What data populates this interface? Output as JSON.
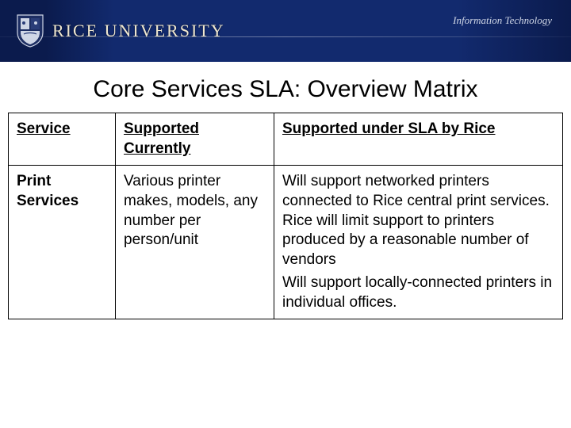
{
  "header": {
    "university": "RICE UNIVERSITY",
    "right_label": "Information Technology"
  },
  "title": "Core Services SLA: Overview Matrix",
  "table": {
    "headers": {
      "service": "Service",
      "supported": "Supported Currently",
      "sla": "Supported under SLA by Rice"
    },
    "row": {
      "service": "Print Services",
      "supported": "Various printer makes, models, any number per person/unit",
      "sla_p1": "Will support networked printers connected to Rice central print services. Rice will limit support to printers produced by a reasonable number of vendors",
      "sla_p2": "Will support locally-connected printers in individual offices."
    }
  }
}
